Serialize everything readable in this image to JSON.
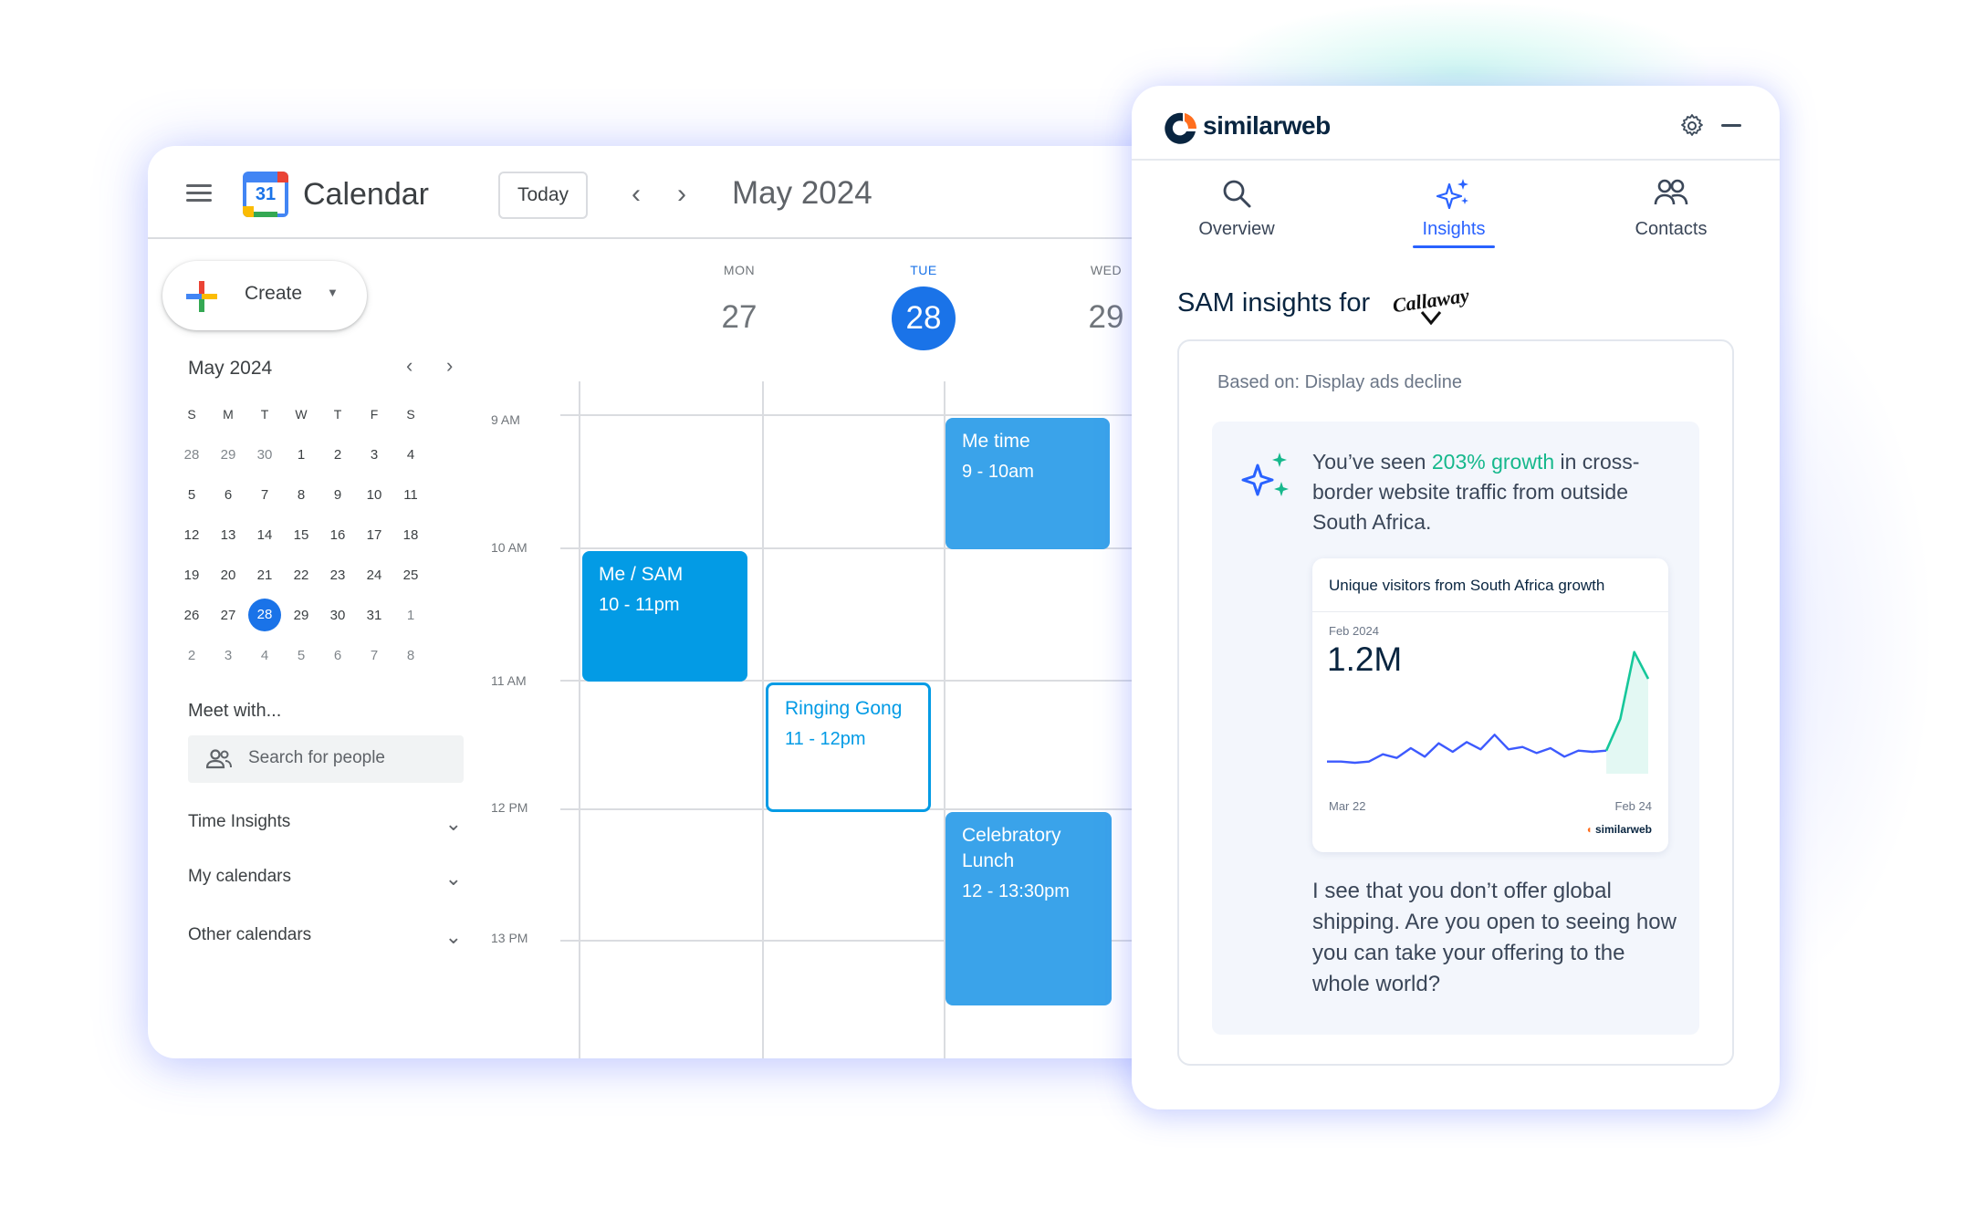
{
  "calendar": {
    "app_title": "Calendar",
    "logo_number": "31",
    "today_label": "Today",
    "month_title": "May 2024",
    "create_label": "Create",
    "mini": {
      "title": "May 2024",
      "weekdays": [
        "S",
        "M",
        "T",
        "W",
        "T",
        "F",
        "S"
      ],
      "weeks": [
        [
          "28",
          "29",
          "30",
          "1",
          "2",
          "3",
          "4"
        ],
        [
          "5",
          "6",
          "7",
          "8",
          "9",
          "10",
          "11"
        ],
        [
          "12",
          "13",
          "14",
          "15",
          "16",
          "17",
          "18"
        ],
        [
          "19",
          "20",
          "21",
          "22",
          "23",
          "24",
          "25"
        ],
        [
          "26",
          "27",
          "28",
          "29",
          "30",
          "31",
          "1"
        ],
        [
          "2",
          "3",
          "4",
          "5",
          "6",
          "7",
          "8"
        ]
      ],
      "selected": "28"
    },
    "meet_title": "Meet with...",
    "search_placeholder": "Search for people",
    "sections": [
      "Time Insights",
      "My calendars",
      "Other calendars"
    ],
    "days": [
      {
        "dow": "MON",
        "dom": "27"
      },
      {
        "dow": "TUE",
        "dom": "28"
      },
      {
        "dow": "WED",
        "dom": "29"
      }
    ],
    "times": [
      "9 AM",
      "10 AM",
      "11 AM",
      "12 PM",
      "13 PM"
    ],
    "events": [
      {
        "title": "Me time",
        "time": "9 - 10am"
      },
      {
        "title": "Me / SAM",
        "time": "10 - 11pm"
      },
      {
        "title": "Ringing Gong",
        "time": "11 - 12pm"
      },
      {
        "title": "Celebratory Lunch",
        "time": "12 - 13:30pm"
      }
    ]
  },
  "similarweb": {
    "brand": "similarweb",
    "tabs": [
      {
        "label": "Overview",
        "icon": "search-icon"
      },
      {
        "label": "Insights",
        "icon": "sparkle-icon"
      },
      {
        "label": "Contacts",
        "icon": "people-icon"
      }
    ],
    "active_tab": "Insights",
    "sam_title": "SAM insights for",
    "company_logo_text": "Callaway",
    "based_on": "Based on:  Display ads decline",
    "insight_pre": "You’ve seen ",
    "insight_highlight": "203% growth",
    "insight_post": " in cross-border website traffic from outside South Africa.",
    "highlight_color": "#16b88c",
    "chart_card": {
      "title": "Unique visitors from South Africa growth",
      "date_label": "Feb 2024",
      "value": "1.2M",
      "x_start": "Mar 22",
      "x_end": "Feb 24",
      "brand": "similarweb"
    },
    "question": "I see that you don’t offer global shipping. Are you open to seeing how you can take your offering to the whole world?"
  },
  "chart_data": {
    "type": "line",
    "title": "Unique visitors from South Africa growth",
    "x": [
      "Mar 22",
      "",
      "",
      "",
      "",
      "",
      "",
      "",
      "",
      "",
      "",
      "",
      "",
      "",
      "",
      "",
      "",
      "",
      "",
      "",
      "",
      "",
      "",
      "Feb 24"
    ],
    "series": [
      {
        "values": [
          0.1,
          0.1,
          0.09,
          0.1,
          0.16,
          0.13,
          0.21,
          0.14,
          0.25,
          0.18,
          0.26,
          0.2,
          0.32,
          0.2,
          0.22,
          0.17,
          0.21,
          0.14,
          0.19,
          0.18,
          0.19,
          0.45,
          1.0,
          0.78
        ]
      }
    ],
    "ylim": [
      0,
      1.05
    ],
    "accent_colors": [
      "#3d5afe",
      "#16c79a"
    ]
  }
}
